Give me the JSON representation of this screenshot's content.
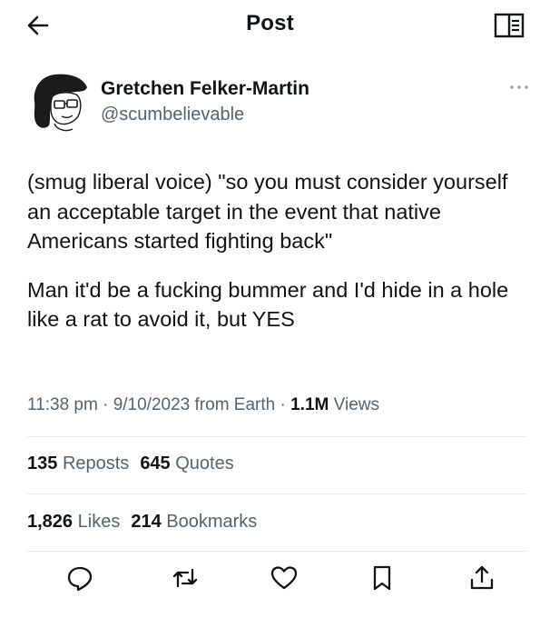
{
  "header": {
    "title": "Post",
    "back_icon": "arrow-left-icon",
    "reader_icon": "reader-mode-icon"
  },
  "author": {
    "name": "Gretchen Felker-Martin",
    "handle": "@scumbelievable",
    "avatar_icon": "avatar-illustration"
  },
  "post": {
    "paragraphs": [
      "(smug liberal voice) \"so you must consider yourself an acceptable target in the event that native Americans started fighting back\"",
      "Man it'd be a fucking bummer and I'd hide in a hole like a rat to avoid it, but YES"
    ]
  },
  "meta": {
    "time": "11:38 pm",
    "date": "9/10/2023",
    "source": "from Earth",
    "views_count": "1.1M",
    "views_label": "Views",
    "separator": "·"
  },
  "stats": {
    "reposts_count": "135",
    "reposts_label": "Reposts",
    "quotes_count": "645",
    "quotes_label": "Quotes",
    "likes_count": "1,826",
    "likes_label": "Likes",
    "bookmarks_count": "214",
    "bookmarks_label": "Bookmarks"
  },
  "actions": [
    "reply-icon",
    "repost-icon",
    "like-icon",
    "bookmark-icon",
    "share-icon"
  ],
  "colors": {
    "text": "#0f1419",
    "secondary": "#536471",
    "divider": "#e7e9ea",
    "background": "#ffffff"
  }
}
